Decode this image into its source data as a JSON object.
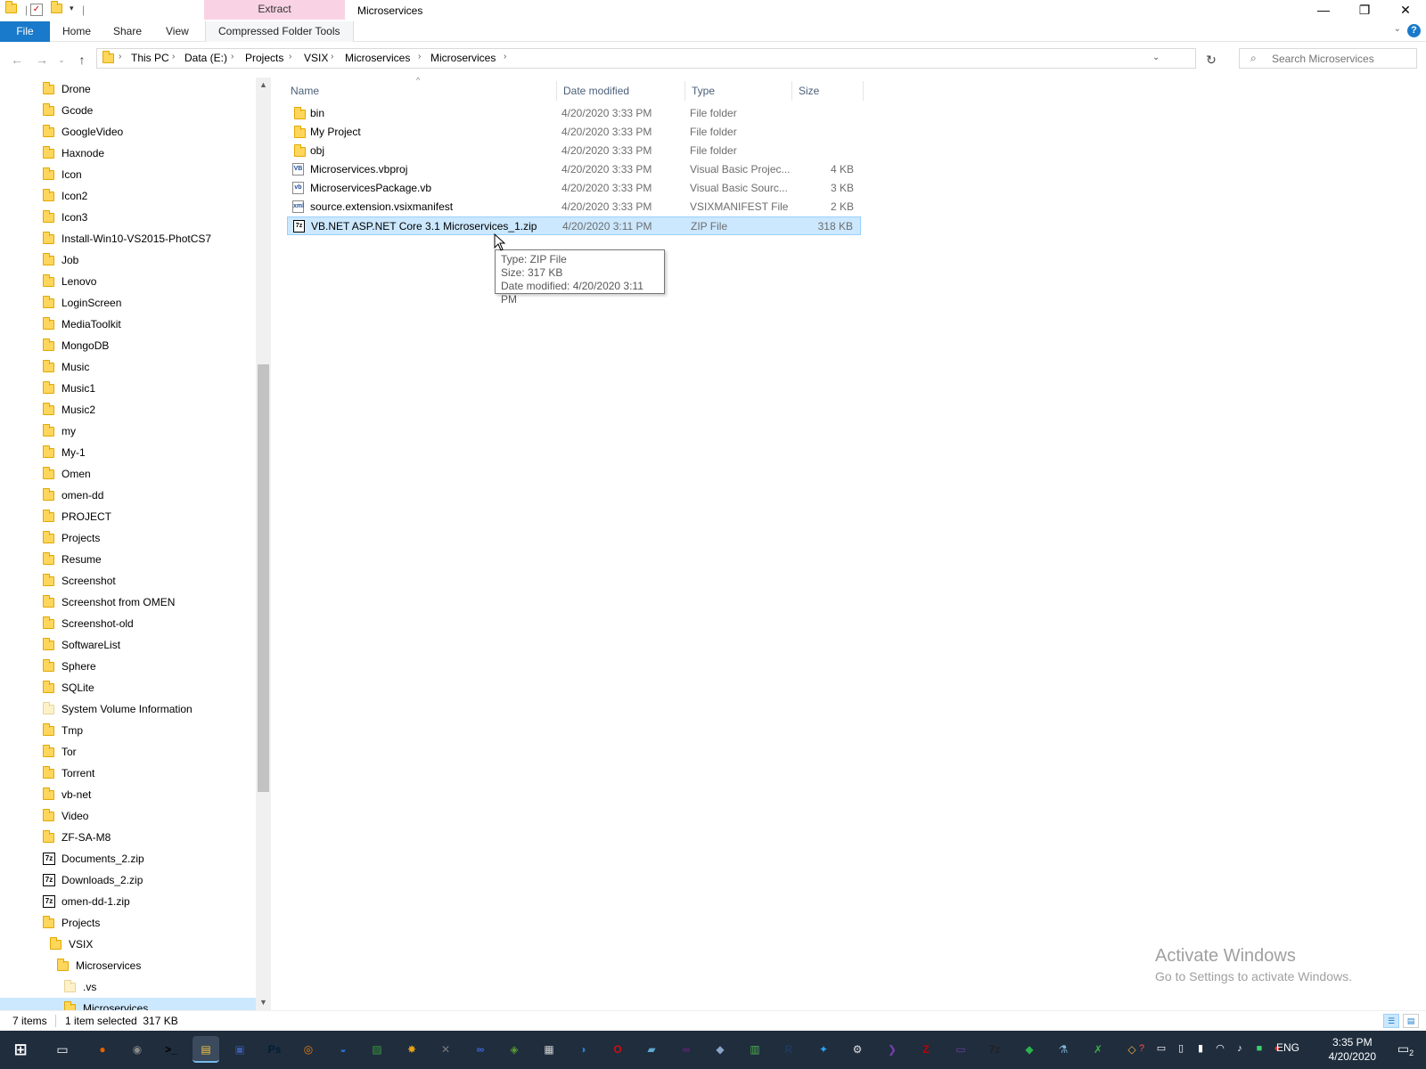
{
  "window": {
    "title": "Microservices",
    "context_tab": "Extract",
    "minimize": "—",
    "maximize": "❐",
    "close": "✕"
  },
  "ribbon": {
    "tabs": [
      "File",
      "Home",
      "Share",
      "View",
      "Compressed Folder Tools"
    ],
    "help": "?"
  },
  "address": {
    "crumbs": [
      "This PC",
      "Data (E:)",
      "Projects",
      "VSIX",
      "Microservices",
      "Microservices"
    ],
    "search_placeholder": "Search Microservices"
  },
  "nav_tree": [
    {
      "label": "Drone",
      "kind": "folder"
    },
    {
      "label": "Gcode",
      "kind": "folder"
    },
    {
      "label": "GoogleVideo",
      "kind": "folder"
    },
    {
      "label": "Haxnode",
      "kind": "folder"
    },
    {
      "label": "Icon",
      "kind": "folder"
    },
    {
      "label": "Icon2",
      "kind": "folder"
    },
    {
      "label": "Icon3",
      "kind": "folder"
    },
    {
      "label": "Install-Win10-VS2015-PhotCS7",
      "kind": "folder"
    },
    {
      "label": "Job",
      "kind": "folder"
    },
    {
      "label": "Lenovo",
      "kind": "folder"
    },
    {
      "label": "LoginScreen",
      "kind": "folder"
    },
    {
      "label": "MediaToolkit",
      "kind": "folder"
    },
    {
      "label": "MongoDB",
      "kind": "folder"
    },
    {
      "label": "Music",
      "kind": "folder"
    },
    {
      "label": "Music1",
      "kind": "folder"
    },
    {
      "label": "Music2",
      "kind": "folder"
    },
    {
      "label": "my",
      "kind": "folder"
    },
    {
      "label": "My-1",
      "kind": "folder"
    },
    {
      "label": "Omen",
      "kind": "folder"
    },
    {
      "label": "omen-dd",
      "kind": "folder"
    },
    {
      "label": "PROJECT",
      "kind": "folder"
    },
    {
      "label": "Projects",
      "kind": "folder"
    },
    {
      "label": "Resume",
      "kind": "folder"
    },
    {
      "label": "Screenshot",
      "kind": "folder"
    },
    {
      "label": "Screenshot from OMEN",
      "kind": "folder"
    },
    {
      "label": "Screenshot-old",
      "kind": "folder"
    },
    {
      "label": "SoftwareList",
      "kind": "folder"
    },
    {
      "label": "Sphere",
      "kind": "folder"
    },
    {
      "label": "SQLite",
      "kind": "folder"
    },
    {
      "label": "System Volume Information",
      "kind": "folder-pale"
    },
    {
      "label": "Tmp",
      "kind": "folder"
    },
    {
      "label": "Tor",
      "kind": "folder"
    },
    {
      "label": "Torrent",
      "kind": "folder"
    },
    {
      "label": "vb-net",
      "kind": "folder"
    },
    {
      "label": "Video",
      "kind": "folder"
    },
    {
      "label": "ZF-SA-M8",
      "kind": "folder"
    },
    {
      "label": "Documents_2.zip",
      "kind": "zip"
    },
    {
      "label": "Downloads_2.zip",
      "kind": "zip"
    },
    {
      "label": "omen-dd-1.zip",
      "kind": "zip"
    },
    {
      "label": "Projects",
      "kind": "folder",
      "depth": 0
    },
    {
      "label": "VSIX",
      "kind": "folder",
      "depth": 1
    },
    {
      "label": "Microservices",
      "kind": "folder",
      "depth": 2
    },
    {
      "label": ".vs",
      "kind": "folder-pale",
      "depth": 3
    },
    {
      "label": "Microservices",
      "kind": "folder",
      "depth": 3,
      "selected": true
    }
  ],
  "columns": {
    "name": "Name",
    "date": "Date modified",
    "type": "Type",
    "size": "Size"
  },
  "files": [
    {
      "name": "bin",
      "date": "4/20/2020 3:33 PM",
      "type": "File folder",
      "size": "",
      "icon": "folder"
    },
    {
      "name": "My Project",
      "date": "4/20/2020 3:33 PM",
      "type": "File folder",
      "size": "",
      "icon": "folder"
    },
    {
      "name": "obj",
      "date": "4/20/2020 3:33 PM",
      "type": "File folder",
      "size": "",
      "icon": "folder"
    },
    {
      "name": "Microservices.vbproj",
      "date": "4/20/2020 3:33 PM",
      "type": "Visual Basic Projec...",
      "size": "4 KB",
      "icon": "VB"
    },
    {
      "name": "MicroservicesPackage.vb",
      "date": "4/20/2020 3:33 PM",
      "type": "Visual Basic Sourc...",
      "size": "3 KB",
      "icon": "vb"
    },
    {
      "name": "source.extension.vsixmanifest",
      "date": "4/20/2020 3:33 PM",
      "type": "VSIXMANIFEST File",
      "size": "2 KB",
      "icon": "xml"
    },
    {
      "name": "VB.NET ASP.NET Core 3.1 Microservices_1.zip",
      "date": "4/20/2020 3:11 PM",
      "type": "ZIP File",
      "size": "318 KB",
      "icon": "7z",
      "selected": true
    }
  ],
  "tooltip": {
    "line1": "Type: ZIP File",
    "line2": "Size: 317 KB",
    "line3": "Date modified: 4/20/2020 3:11 PM"
  },
  "watermark": {
    "title": "Activate Windows",
    "subtitle": "Go to Settings to activate Windows."
  },
  "status": {
    "items": "7 items",
    "selection": "1 item selected  317 KB"
  },
  "taskbar": {
    "lang": "ENG",
    "time": "3:35 PM",
    "date": "4/20/2020",
    "notifications": "2",
    "apps": [
      {
        "name": "firefox",
        "glyph": "●",
        "color": "#e66000"
      },
      {
        "name": "app-2",
        "glyph": "◉",
        "color": "#8a8a8a"
      },
      {
        "name": "terminal",
        "glyph": ">_",
        "color": "#000000"
      },
      {
        "name": "file-explorer",
        "glyph": "▤",
        "color": "#f4c542",
        "active": true
      },
      {
        "name": "app-5",
        "glyph": "▣",
        "color": "#3a5aa8"
      },
      {
        "name": "photoshop",
        "glyph": "Ps",
        "color": "#001e36"
      },
      {
        "name": "blender",
        "glyph": "◎",
        "color": "#e87d0d"
      },
      {
        "name": "app-8",
        "glyph": "◒",
        "color": "#2a6fdb"
      },
      {
        "name": "app-9",
        "glyph": "▨",
        "color": "#3c9a3c"
      },
      {
        "name": "app-10",
        "glyph": "✸",
        "color": "#e8a317"
      },
      {
        "name": "app-11",
        "glyph": "✕",
        "color": "#7a7a7a"
      },
      {
        "name": "app-12",
        "glyph": "∞",
        "color": "#4169e1"
      },
      {
        "name": "app-13",
        "glyph": "◈",
        "color": "#5a9e2f"
      },
      {
        "name": "app-14",
        "glyph": "▦",
        "color": "#d0d0d0"
      },
      {
        "name": "app-15",
        "glyph": "◑",
        "color": "#2b7bd6"
      },
      {
        "name": "opera",
        "glyph": "O",
        "color": "#cc0f16"
      },
      {
        "name": "app-17",
        "glyph": "▰",
        "color": "#5fa8d3"
      },
      {
        "name": "visual-studio",
        "glyph": "∞",
        "color": "#68217a"
      },
      {
        "name": "app-19",
        "glyph": "◆",
        "color": "#8aa4c8"
      },
      {
        "name": "app-20",
        "glyph": "▥",
        "color": "#4caf50"
      },
      {
        "name": "app-21",
        "glyph": "R",
        "color": "#1e3a5f"
      },
      {
        "name": "app-22",
        "glyph": "✦",
        "color": "#2ea3f2"
      },
      {
        "name": "app-23",
        "glyph": "⚙",
        "color": "#e0e0e0"
      },
      {
        "name": "vs-code",
        "glyph": "❯",
        "color": "#7b3fb3"
      },
      {
        "name": "filezilla",
        "glyph": "Z",
        "color": "#bf0000"
      },
      {
        "name": "app-26",
        "glyph": "▭",
        "color": "#6b3fa0"
      },
      {
        "name": "7zip",
        "glyph": "7z",
        "color": "#222222"
      },
      {
        "name": "app-28",
        "glyph": "◆",
        "color": "#2bb24c"
      },
      {
        "name": "app-29",
        "glyph": "⚗",
        "color": "#7fb3d5"
      },
      {
        "name": "app-30",
        "glyph": "✗",
        "color": "#3cb043"
      },
      {
        "name": "app-31",
        "glyph": "◇",
        "color": "#f5b041"
      }
    ]
  }
}
